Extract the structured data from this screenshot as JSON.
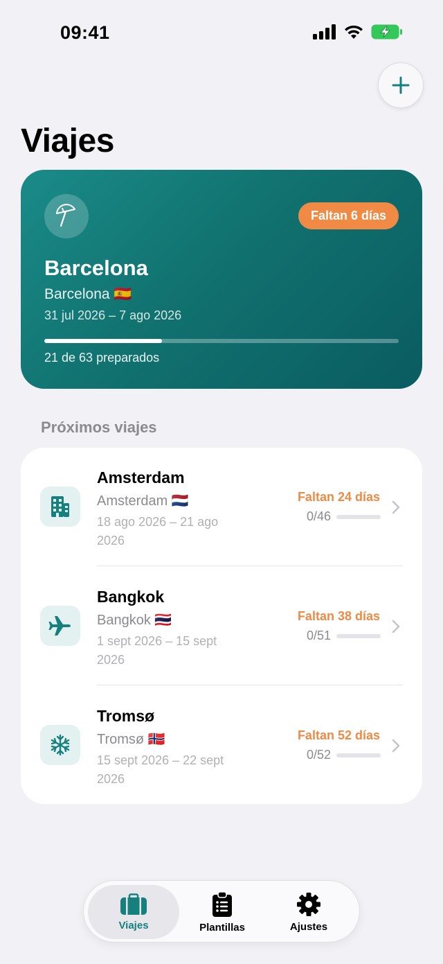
{
  "status_bar": {
    "time": "09:41"
  },
  "header": {
    "title": "Viajes",
    "add_icon": "plus-icon"
  },
  "featured_trip": {
    "icon": "beach-umbrella-icon",
    "badge": "Faltan 6 días",
    "title": "Barcelona",
    "destination": "Barcelona 🇪🇸",
    "dates": "31 jul 2026 – 7 ago 2026",
    "progress_fraction": 0.333,
    "progress_text": "21 de 63 preparados"
  },
  "upcoming": {
    "header": "Próximos viajes",
    "trips": [
      {
        "icon": "building-icon",
        "name": "Amsterdam",
        "destination": "Amsterdam 🇳🇱",
        "dates": "18 ago 2026 – 21 ago 2026",
        "countdown": "Faltan 24 días",
        "count": "0/46",
        "progress_fraction": 0
      },
      {
        "icon": "airplane-icon",
        "name": "Bangkok",
        "destination": "Bangkok 🇹🇭",
        "dates": "1 sept 2026 – 15 sept 2026",
        "countdown": "Faltan 38 días",
        "count": "0/51",
        "progress_fraction": 0
      },
      {
        "icon": "snowflake-icon",
        "name": "Tromsø",
        "destination": "Tromsø 🇳🇴",
        "dates": "15 sept 2026 – 22 sept 2026",
        "countdown": "Faltan 52 días",
        "count": "0/52",
        "progress_fraction": 0
      }
    ]
  },
  "tab_bar": {
    "tabs": [
      {
        "label": "Viajes",
        "icon": "suitcase-icon",
        "active": true
      },
      {
        "label": "Plantillas",
        "icon": "clipboard-list-icon",
        "active": false
      },
      {
        "label": "Ajustes",
        "icon": "gear-icon",
        "active": false
      }
    ]
  },
  "colors": {
    "accent": "#15807d",
    "countdown": "#ee8a44",
    "background": "#f1f1f6"
  }
}
